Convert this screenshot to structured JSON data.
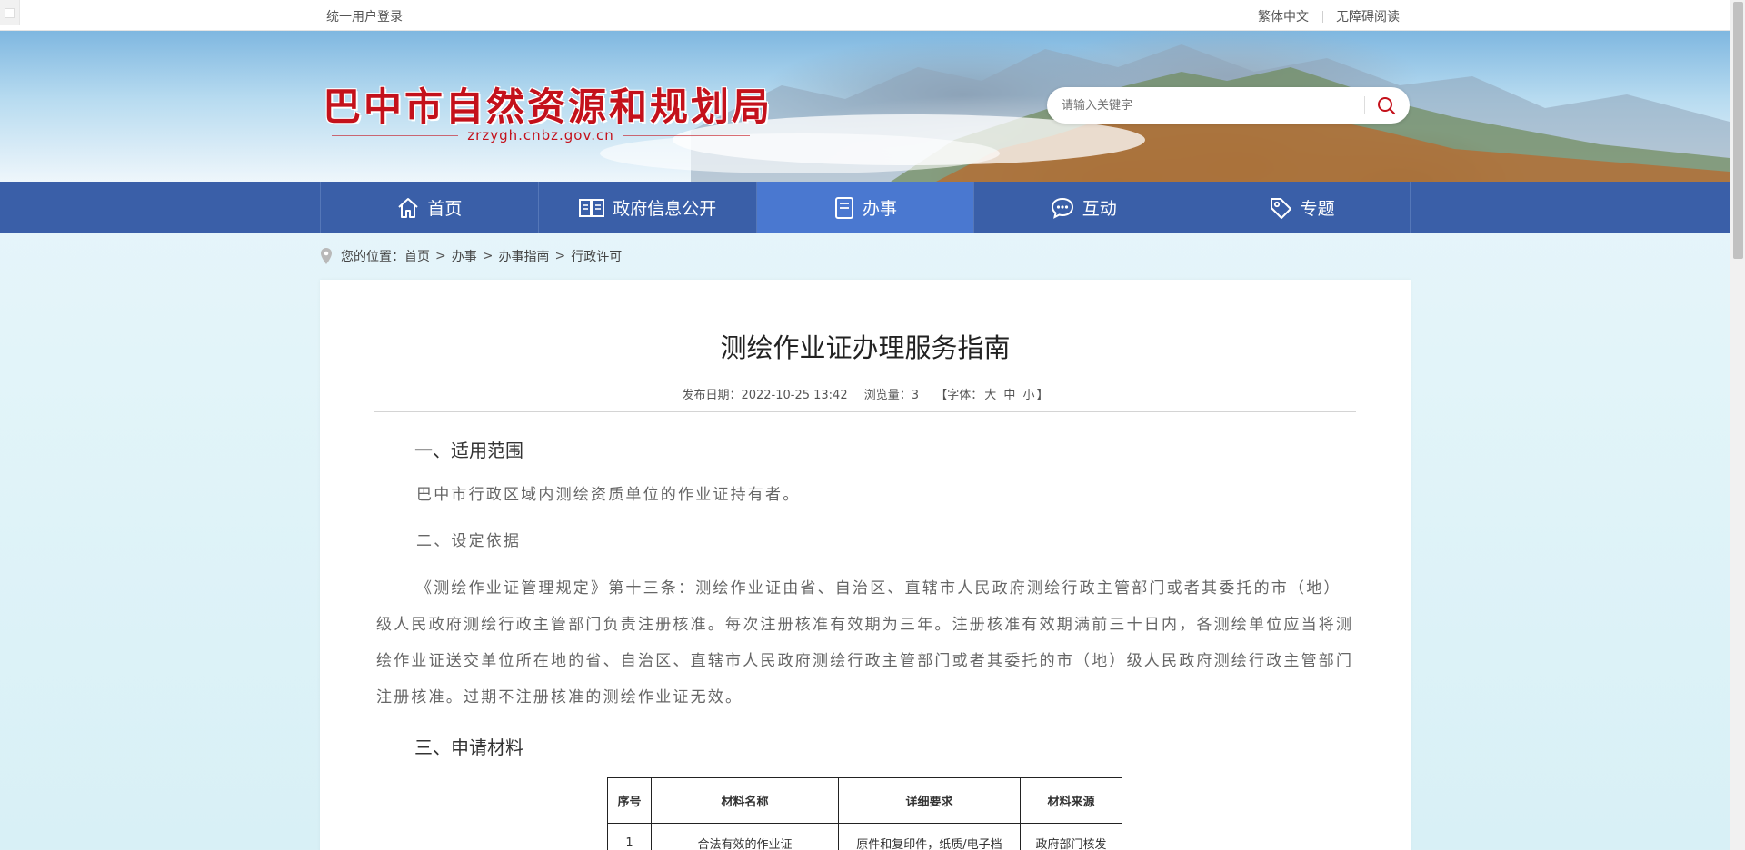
{
  "topbar": {
    "login": "统一用户登录",
    "traditional": "繁体中文",
    "accessible": "无障碍阅读"
  },
  "header": {
    "site_title": "巴中市自然资源和规划局",
    "site_domain": "zrzygh.cnbz.gov.cn",
    "search_placeholder": "请输入关键字"
  },
  "nav": {
    "items": [
      {
        "label": "首页",
        "icon": "home-icon"
      },
      {
        "label": "政府信息公开",
        "icon": "book-icon"
      },
      {
        "label": "办事",
        "icon": "document-icon",
        "active": true
      },
      {
        "label": "互动",
        "icon": "chat-icon"
      },
      {
        "label": "专题",
        "icon": "tag-icon"
      }
    ]
  },
  "breadcrumb": {
    "prefix": "您的位置：",
    "items": [
      "首页",
      "办事",
      "办事指南",
      "行政许可"
    ],
    "separator": ">"
  },
  "article": {
    "title": "测绘作业证办理服务指南",
    "publish_label": "发布日期：",
    "publish_date": "2022-10-25 13:42",
    "views_label": "浏览量：",
    "views": "3",
    "font_label": "【字体：",
    "font_large": "大",
    "font_medium": "中",
    "font_small": "小",
    "font_end": "】",
    "section1_heading": "一、适用范围",
    "section1_text": "巴中市行政区域内测绘资质单位的作业证持有者。",
    "section2_heading": "二、设定依据",
    "section2_text": "《测绘作业证管理规定》第十三条：测绘作业证由省、自治区、直辖市人民政府测绘行政主管部门或者其委托的市（地）级人民政府测绘行政主管部门负责注册核准。每次注册核准有效期为三年。注册核准有效期满前三十日内，各测绘单位应当将测绘作业证送交单位所在地的省、自治区、直辖市人民政府测绘行政主管部门或者其委托的市（地）级人民政府测绘行政主管部门注册核准。过期不注册核准的测绘作业证无效。",
    "section3_heading": "三、申请材料",
    "table": {
      "headers": [
        "序号",
        "材料名称",
        "详细要求",
        "材料来源"
      ],
      "rows": [
        [
          "1",
          "合法有效的作业证",
          "原件和复印件，纸质/电子档",
          "政府部门核发"
        ]
      ]
    }
  },
  "colors": {
    "nav_bg": "#3a5fa8",
    "nav_active": "#4a78d0",
    "brand_red": "#c4111b"
  }
}
